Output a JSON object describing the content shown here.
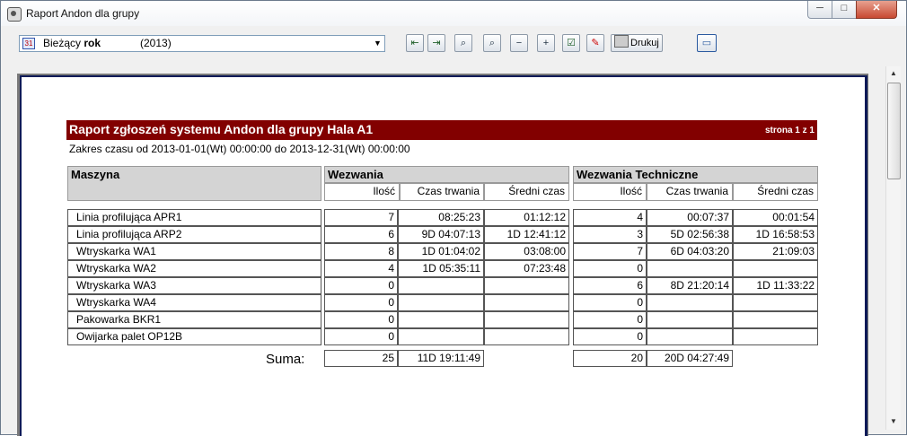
{
  "window": {
    "title": "Raport Andon dla grupy",
    "minimize": "─",
    "maximize": "□",
    "close": "✕"
  },
  "toolbar": {
    "period_label_a": "Bieżący",
    "period_label_b": "rok",
    "period_value": "(2013)",
    "period_icon": "calendar-icon",
    "dropdown_glyph": "▼",
    "print_label": "Drukuj",
    "icons": [
      "first-page-icon",
      "last-page-icon",
      "zoom-page-icon",
      "zoom-width-icon",
      "zoom-out-icon",
      "zoom-in-icon",
      "checkbox-icon",
      "pdf-export-icon",
      "printer-icon",
      "window-icon"
    ]
  },
  "report": {
    "title": "Raport zgłoszeń systemu Andon dla grupy  Hala A1",
    "page": "strona 1 z 1",
    "range": "Zakres czasu od 2013-01-01(Wt) 00:00:00 do 2013-12-31(Wt) 00:00:00",
    "col_machine": "Maszyna",
    "group1": "Wezwania",
    "group2": "Wezwania Techniczne",
    "sub_count": "Ilość",
    "sub_duration": "Czas trwania",
    "sub_avg": "Średni czas",
    "sum_label": "Suma:",
    "rows": [
      {
        "name": "Linia profilująca APR1",
        "c1": "7",
        "d1": "08:25:23",
        "a1": "01:12:12",
        "c2": "4",
        "d2": "00:07:37",
        "a2": "00:01:54"
      },
      {
        "name": "Linia profilująca ARP2",
        "c1": "6",
        "d1": "9D 04:07:13",
        "a1": "1D 12:41:12",
        "c2": "3",
        "d2": "5D 02:56:38",
        "a2": "1D 16:58:53"
      },
      {
        "name": "Wtryskarka WA1",
        "c1": "8",
        "d1": "1D 01:04:02",
        "a1": "03:08:00",
        "c2": "7",
        "d2": "6D 04:03:20",
        "a2": "21:09:03"
      },
      {
        "name": "Wtryskarka WA2",
        "c1": "4",
        "d1": "1D 05:35:11",
        "a1": "07:23:48",
        "c2": "0",
        "d2": "",
        "a2": ""
      },
      {
        "name": "Wtryskarka WA3",
        "c1": "0",
        "d1": "",
        "a1": "",
        "c2": "6",
        "d2": "8D 21:20:14",
        "a2": "1D 11:33:22"
      },
      {
        "name": "Wtryskarka WA4",
        "c1": "0",
        "d1": "",
        "a1": "",
        "c2": "0",
        "d2": "",
        "a2": ""
      },
      {
        "name": "Pakowarka BKR1",
        "c1": "0",
        "d1": "",
        "a1": "",
        "c2": "0",
        "d2": "",
        "a2": ""
      },
      {
        "name": "Owijarka palet OP12B",
        "c1": "0",
        "d1": "",
        "a1": "",
        "c2": "0",
        "d2": "",
        "a2": ""
      }
    ],
    "totals": {
      "c1": "25",
      "d1": "11D 19:11:49",
      "c2": "20",
      "d2": "20D 04:27:49"
    }
  },
  "colors": {
    "header_bar": "#820000",
    "page_border": "#0b1a58",
    "header_fill": "#d4d4d4"
  }
}
